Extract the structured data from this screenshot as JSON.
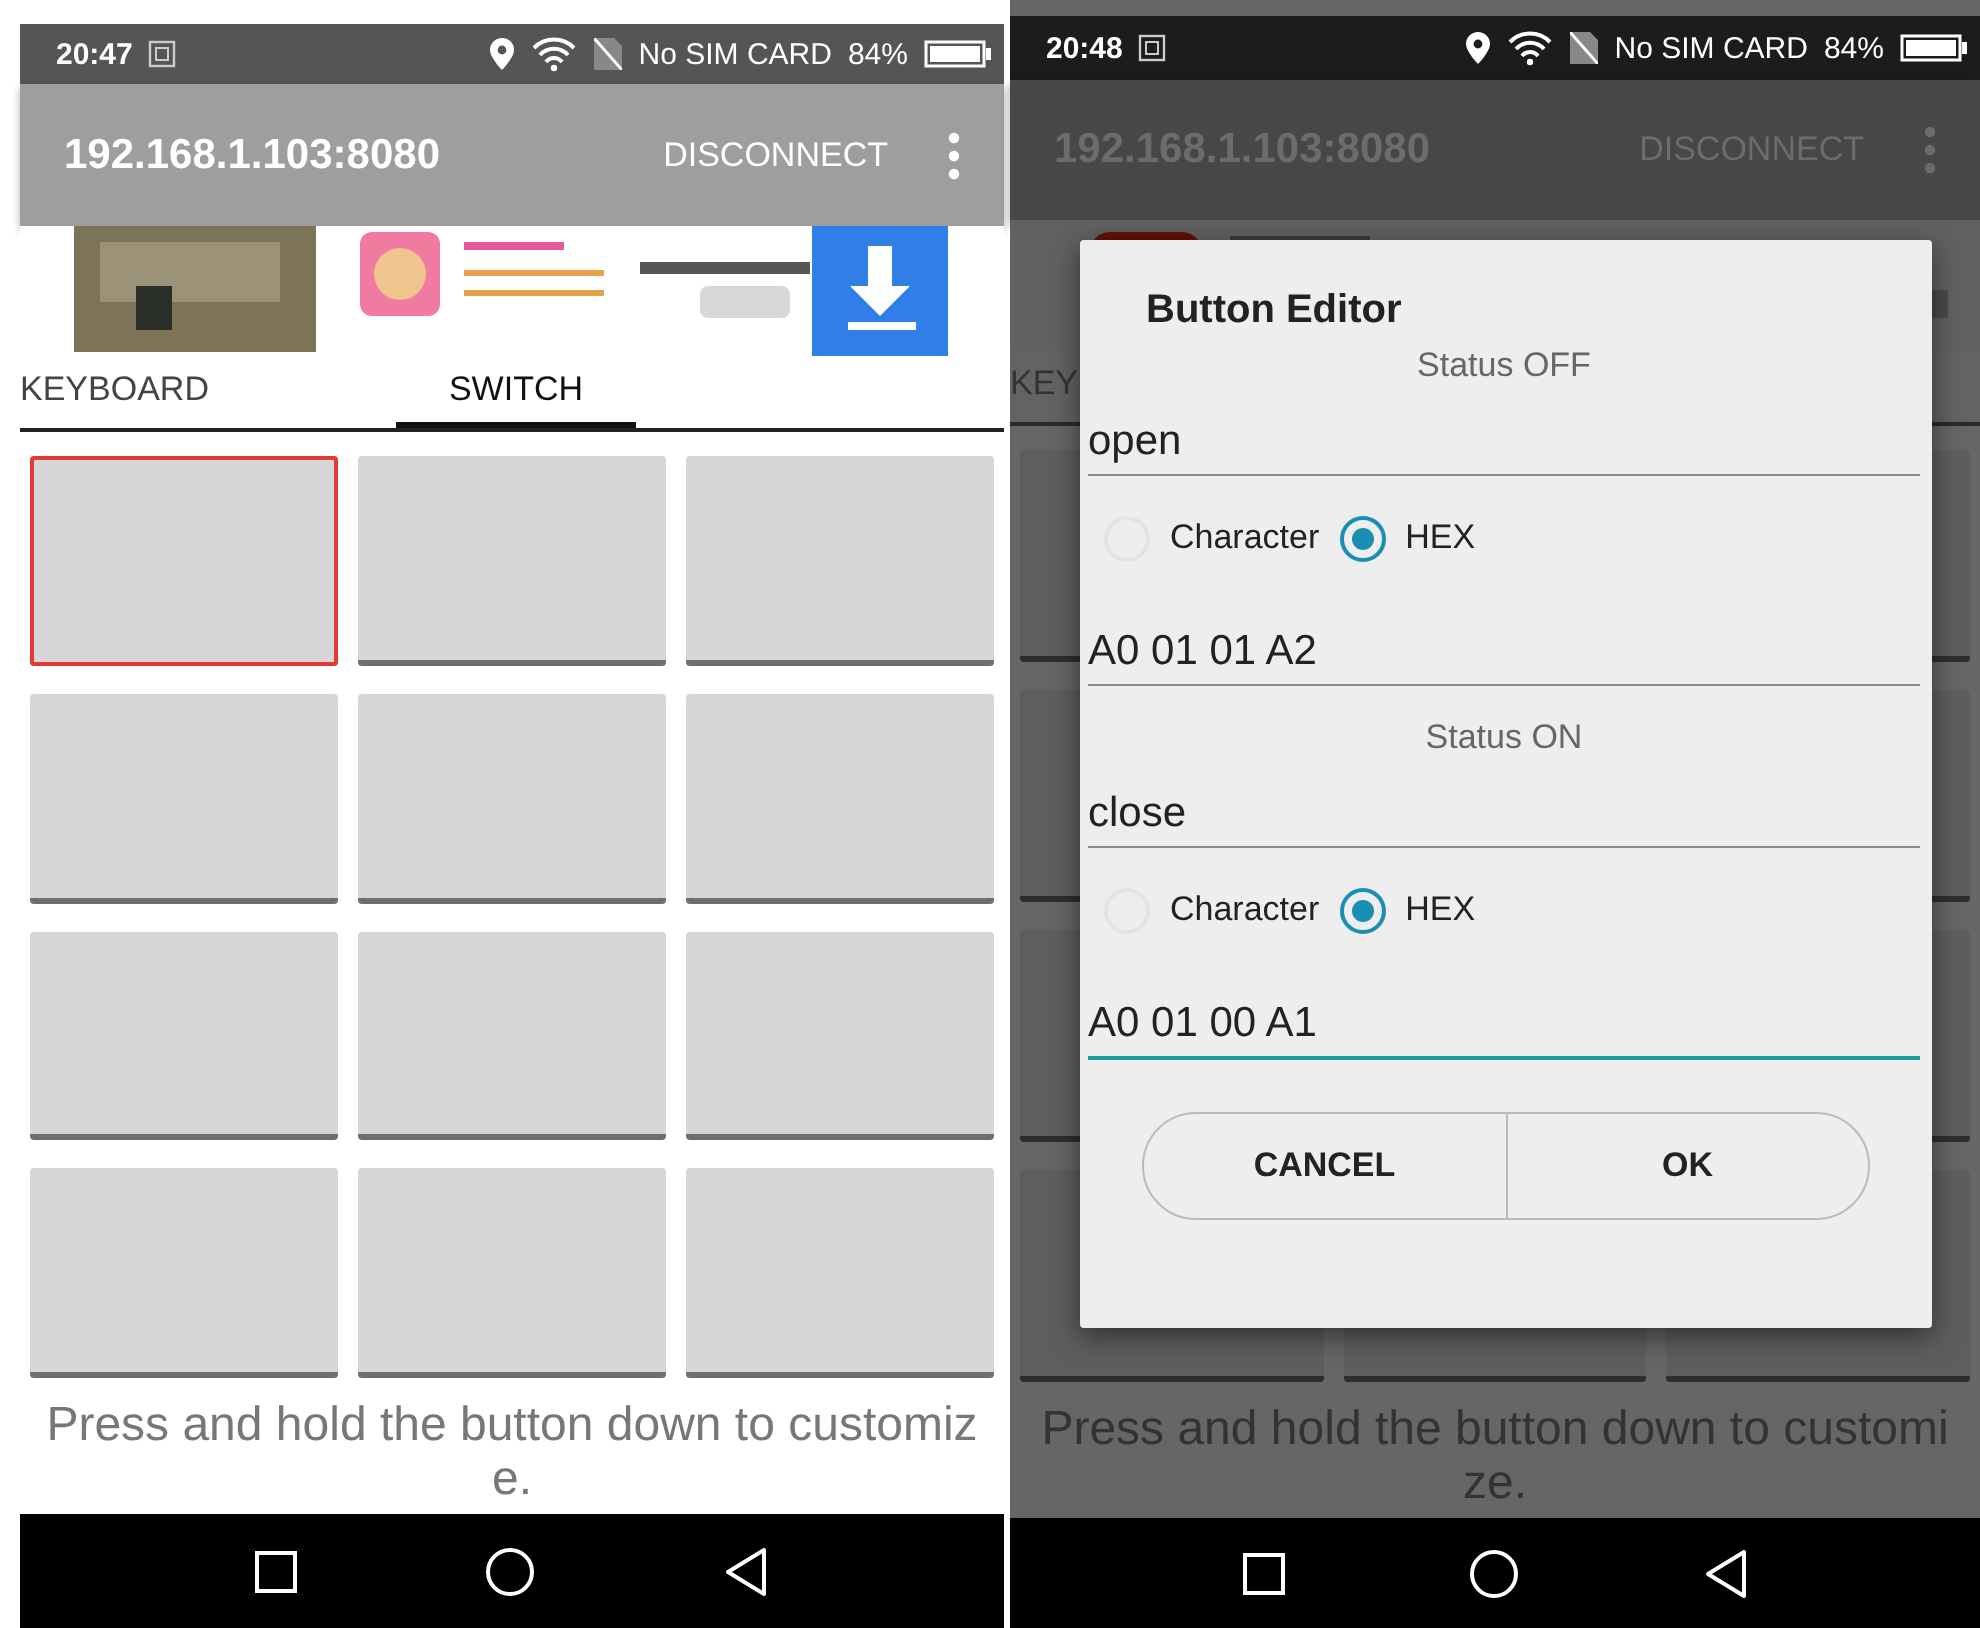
{
  "screens": [
    {
      "dimmed": false,
      "status_bar": {
        "time": "20:47",
        "carrier": "No SIM CARD",
        "battery": "84%"
      },
      "app_bar": {
        "title": "192.168.1.103:8080",
        "action": "DISCONNECT"
      },
      "tabs": [
        {
          "label": "KEYBOARD",
          "selected": false
        },
        {
          "label": "SWITCH",
          "selected": true
        }
      ],
      "buttons": [
        {
          "selected": true
        },
        {
          "selected": false
        },
        {
          "selected": false
        },
        {
          "selected": false
        },
        {
          "selected": false
        },
        {
          "selected": false
        },
        {
          "selected": false
        },
        {
          "selected": false
        },
        {
          "selected": false
        },
        {
          "selected": false
        },
        {
          "selected": false
        },
        {
          "selected": false
        }
      ],
      "hint": "Press and hold the button down to customize."
    },
    {
      "dimmed": true,
      "status_bar": {
        "time": "20:48",
        "carrier": "No SIM CARD",
        "battery": "84%"
      },
      "app_bar": {
        "title": "192.168.1.103:8080",
        "action": "DISCONNECT"
      },
      "tabs": [
        {
          "label": "KEY",
          "selected": false
        }
      ],
      "hint": "Press and hold the button down to customize.",
      "dialog": {
        "title": "Button Editor",
        "sections": [
          {
            "heading": "Status OFF",
            "name": "open",
            "options": [
              {
                "label": "Character",
                "selected": false
              },
              {
                "label": "HEX",
                "selected": true
              }
            ],
            "code": "A0 01 01 A2",
            "focused": false
          },
          {
            "heading": "Status ON",
            "name": "close",
            "options": [
              {
                "label": "Character",
                "selected": false
              },
              {
                "label": "HEX",
                "selected": true
              }
            ],
            "code": "A0 01 00 A1",
            "focused": true
          }
        ],
        "buttons": [
          "CANCEL",
          "OK"
        ]
      }
    }
  ]
}
